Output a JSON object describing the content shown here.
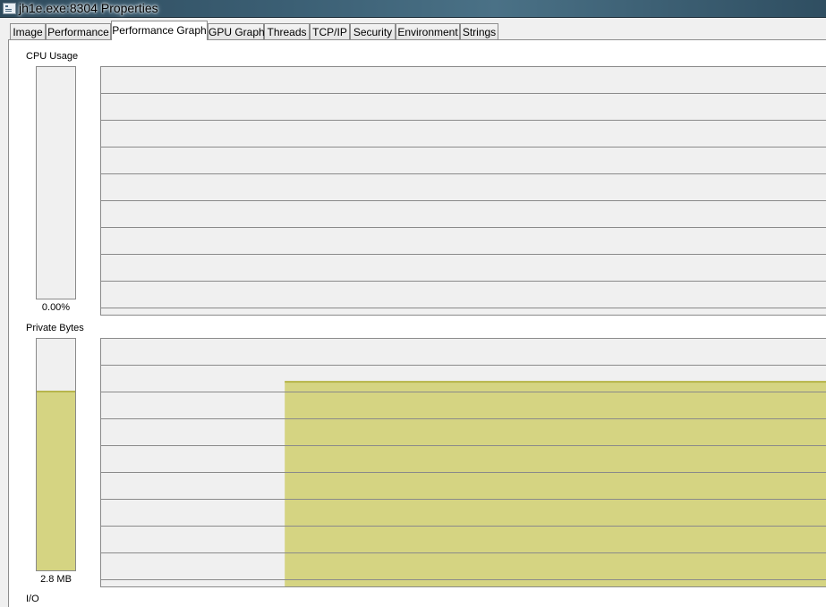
{
  "window": {
    "title": "jh1e.exe:8304 Properties",
    "icon": "window-app-icon"
  },
  "tabs": [
    {
      "label": "Image",
      "active": false
    },
    {
      "label": "Performance",
      "active": false
    },
    {
      "label": "Performance Graph",
      "active": true
    },
    {
      "label": "GPU Graph",
      "active": false
    },
    {
      "label": "Threads",
      "active": false
    },
    {
      "label": "TCP/IP",
      "active": false
    },
    {
      "label": "Security",
      "active": false
    },
    {
      "label": "Environment",
      "active": false
    },
    {
      "label": "Strings",
      "active": false
    }
  ],
  "colors": {
    "fill": "#d5d482",
    "fill_edge": "#b7b54c",
    "graph_bg": "#f0f0f0",
    "grid": "#8a8a8a"
  },
  "cpu": {
    "label": "CPU Usage",
    "value_text": "0.00%",
    "fraction": 0.0
  },
  "private_bytes": {
    "label": "Private Bytes",
    "value_text": "2.8 MB",
    "fraction": 0.77,
    "history_start_fraction": 0.253,
    "history_level": 0.83
  },
  "io": {
    "label": "I/O"
  }
}
